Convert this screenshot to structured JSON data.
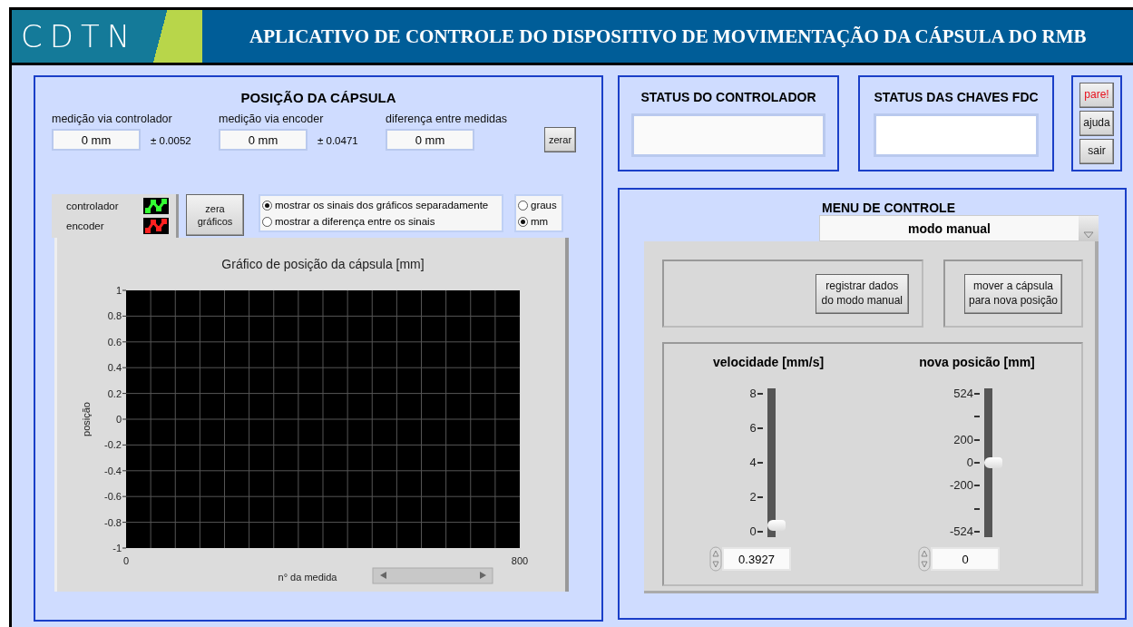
{
  "header": {
    "logo": "CDTN",
    "title": "APLICATIVO DE CONTROLE DO DISPOSITIVO DE MOVIMENTAÇÃO DA CÁPSULA DO RMB"
  },
  "position_panel": {
    "title": "POSIÇÃO DA CÁPSULA",
    "measurements": [
      {
        "label": "medição via controlador",
        "value": "0 mm",
        "tolerance": "± 0.0052"
      },
      {
        "label": "medição via encoder",
        "value": "0 mm",
        "tolerance": "± 0.0471"
      },
      {
        "label": "diferença entre medidas",
        "value": "0 mm"
      }
    ],
    "reset_button": "zerar",
    "legend": [
      {
        "label": "controlador",
        "color": "#33ff33"
      },
      {
        "label": "encoder",
        "color": "#ff2020"
      }
    ],
    "reset_graphs_button": "zera gráficos",
    "display_options": [
      {
        "label": "mostrar os sinais dos gráficos separadamente",
        "selected": true
      },
      {
        "label": "mostrar a diferença entre os sinais",
        "selected": false
      }
    ],
    "unit_options": [
      {
        "label": "graus",
        "selected": false
      },
      {
        "label": "mm",
        "selected": true
      }
    ],
    "chart": {
      "chart_data": {
        "type": "line",
        "title": "Gráfico de posição da cápsula [mm]",
        "xlabel": "n° da medida",
        "ylabel": "posição",
        "xlim": [
          0,
          800
        ],
        "ylim": [
          -1,
          1
        ],
        "xticks": [
          0,
          800
        ],
        "grid": true,
        "yticks": [
          -1,
          -0.8,
          -0.6,
          -0.4,
          -0.2,
          0,
          0.2,
          0.4,
          0.6,
          0.8,
          1
        ]
      }
    }
  },
  "controller_status": {
    "title": "STATUS DO CONTROLADOR"
  },
  "limit_switch_status": {
    "title": "STATUS DAS CHAVES FDC"
  },
  "side_buttons": [
    {
      "label": "pare!",
      "kind": "alert"
    },
    {
      "label": "ajuda",
      "kind": "normal"
    },
    {
      "label": "sair",
      "kind": "normal"
    }
  ],
  "control_menu": {
    "title": "MENU DE CONTROLE",
    "mode": "modo manual",
    "record_button": "registrar dados\ndo modo manual",
    "move_button": "mover a cápsula\npara nova posição",
    "sliders": [
      {
        "title": "velocidade [mm/s]",
        "ticks": [
          {
            "kind": "major",
            "label": "8"
          },
          {
            "kind": "major",
            "label": "6"
          },
          {
            "kind": "major",
            "label": "4"
          },
          {
            "kind": "major",
            "label": "2"
          },
          {
            "kind": "major",
            "label": "0"
          }
        ],
        "level": 0.049,
        "value": "0.3927"
      },
      {
        "title": "nova posicão [mm]",
        "ticks": [
          {
            "kind": "major",
            "label": "524"
          },
          {
            "kind": "minor"
          },
          {
            "kind": "major",
            "label": "200"
          },
          {
            "kind": "major",
            "label": "0"
          },
          {
            "kind": "major",
            "label": "-200"
          },
          {
            "kind": "minor"
          },
          {
            "kind": "major",
            "label": "-524"
          }
        ],
        "level": 0.5,
        "value": "0"
      }
    ]
  }
}
